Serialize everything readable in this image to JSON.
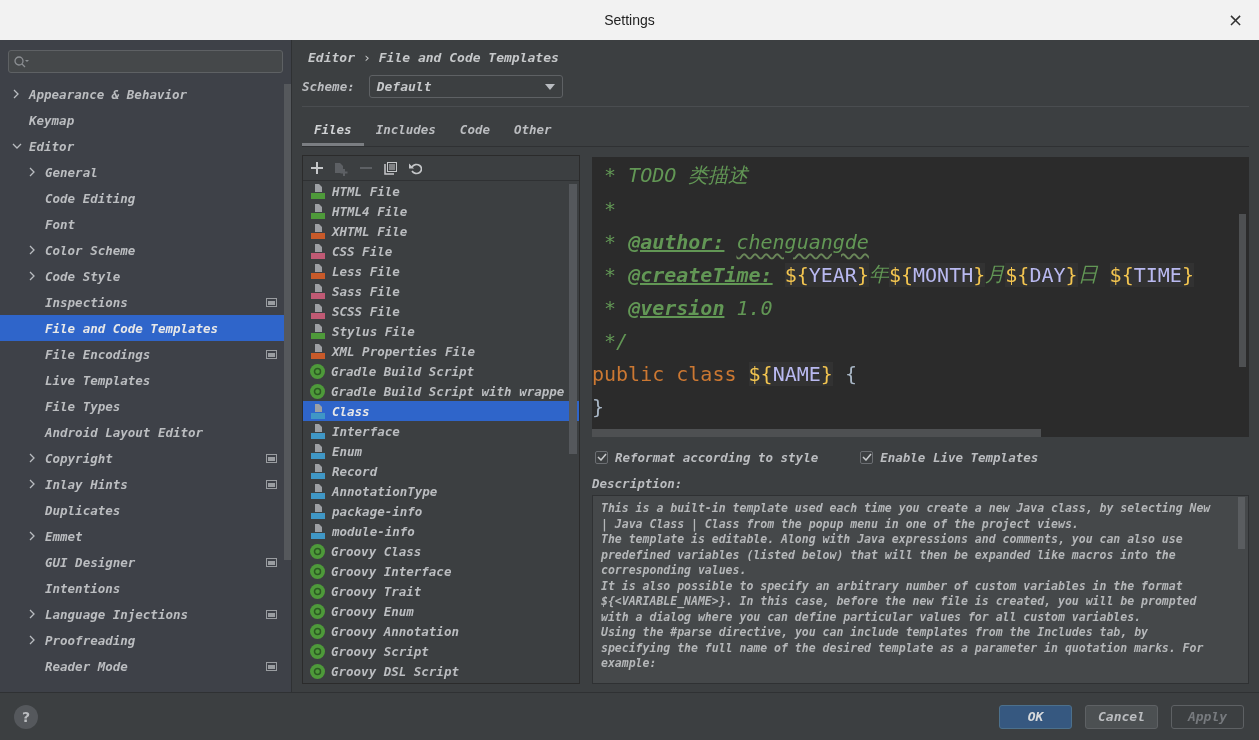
{
  "window": {
    "title": "Settings",
    "close": "×"
  },
  "sidebar": {
    "items": [
      {
        "label": "Appearance & Behavior",
        "expandable": true,
        "expanded": false,
        "project": false,
        "selected": false
      },
      {
        "label": "Keymap",
        "expandable": false,
        "project": false,
        "selected": false
      },
      {
        "label": "Editor",
        "expandable": true,
        "expanded": true,
        "project": false,
        "selected": false,
        "children": [
          {
            "label": "General",
            "expandable": true,
            "expanded": false,
            "project": false,
            "selected": false
          },
          {
            "label": "Code Editing",
            "expandable": false,
            "project": false,
            "selected": false
          },
          {
            "label": "Font",
            "expandable": false,
            "project": false,
            "selected": false
          },
          {
            "label": "Color Scheme",
            "expandable": true,
            "expanded": false,
            "project": false,
            "selected": false
          },
          {
            "label": "Code Style",
            "expandable": true,
            "expanded": false,
            "project": false,
            "selected": false
          },
          {
            "label": "Inspections",
            "expandable": false,
            "project": true,
            "selected": false
          },
          {
            "label": "File and Code Templates",
            "expandable": false,
            "project": false,
            "selected": true
          },
          {
            "label": "File Encodings",
            "expandable": false,
            "project": true,
            "selected": false
          },
          {
            "label": "Live Templates",
            "expandable": false,
            "project": false,
            "selected": false
          },
          {
            "label": "File Types",
            "expandable": false,
            "project": false,
            "selected": false
          },
          {
            "label": "Android Layout Editor",
            "expandable": false,
            "project": false,
            "selected": false
          },
          {
            "label": "Copyright",
            "expandable": true,
            "expanded": false,
            "project": true,
            "selected": false
          },
          {
            "label": "Inlay Hints",
            "expandable": true,
            "expanded": false,
            "project": true,
            "selected": false
          },
          {
            "label": "Duplicates",
            "expandable": false,
            "project": false,
            "selected": false
          },
          {
            "label": "Emmet",
            "expandable": true,
            "expanded": false,
            "project": false,
            "selected": false
          },
          {
            "label": "GUI Designer",
            "expandable": false,
            "project": true,
            "selected": false
          },
          {
            "label": "Intentions",
            "expandable": false,
            "project": false,
            "selected": false
          },
          {
            "label": "Language Injections",
            "expandable": true,
            "expanded": false,
            "project": true,
            "selected": false
          },
          {
            "label": "Proofreading",
            "expandable": true,
            "expanded": false,
            "project": false,
            "selected": false
          },
          {
            "label": "Reader Mode",
            "expandable": false,
            "project": true,
            "selected": false
          }
        ]
      }
    ]
  },
  "breadcrumb": {
    "parent": "Editor",
    "separator": "›",
    "current": "File and Code Templates"
  },
  "scheme": {
    "label": "Scheme:",
    "value": "Default"
  },
  "tabs": [
    {
      "label": "Files",
      "selected": true
    },
    {
      "label": "Includes",
      "selected": false
    },
    {
      "label": "Code",
      "selected": false
    },
    {
      "label": "Other",
      "selected": false
    }
  ],
  "toolbar": [
    {
      "kind": "add",
      "disabled": false
    },
    {
      "kind": "copy-file",
      "disabled": true
    },
    {
      "kind": "remove",
      "disabled": true
    },
    {
      "kind": "copy",
      "disabled": false
    },
    {
      "kind": "reset",
      "disabled": false
    }
  ],
  "templates": [
    {
      "name": "HTML File",
      "kind": "file",
      "color": "#4e9a3a",
      "selected": false
    },
    {
      "name": "HTML4 File",
      "kind": "file",
      "color": "#4e9a3a",
      "selected": false
    },
    {
      "name": "XHTML File",
      "kind": "file",
      "color": "#c85a2a",
      "selected": false
    },
    {
      "name": "CSS File",
      "kind": "file",
      "color": "#c05a74",
      "selected": false
    },
    {
      "name": "Less File",
      "kind": "file",
      "color": "#c85a2a",
      "selected": false
    },
    {
      "name": "Sass File",
      "kind": "file",
      "color": "#c05a74",
      "selected": false
    },
    {
      "name": "SCSS File",
      "kind": "file",
      "color": "#c05a74",
      "selected": false
    },
    {
      "name": "Stylus File",
      "kind": "file",
      "color": "#4e9a3a",
      "selected": false
    },
    {
      "name": "XML Properties File",
      "kind": "file",
      "color": "#c85a2a",
      "selected": false
    },
    {
      "name": "Gradle Build Script",
      "kind": "groovy",
      "color": "#4e9a3a",
      "selected": false
    },
    {
      "name": "Gradle Build Script with wrappe",
      "kind": "groovy",
      "color": "#4e9a3a",
      "selected": false
    },
    {
      "name": "Class",
      "kind": "file",
      "color": "#3f97c6",
      "selected": true
    },
    {
      "name": "Interface",
      "kind": "file",
      "color": "#3f97c6",
      "selected": false
    },
    {
      "name": "Enum",
      "kind": "file",
      "color": "#3f97c6",
      "selected": false
    },
    {
      "name": "Record",
      "kind": "file",
      "color": "#3f97c6",
      "selected": false
    },
    {
      "name": "AnnotationType",
      "kind": "file",
      "color": "#3f97c6",
      "selected": false
    },
    {
      "name": "package-info",
      "kind": "file",
      "color": "#3f97c6",
      "selected": false
    },
    {
      "name": "module-info",
      "kind": "file",
      "color": "#3f97c6",
      "selected": false
    },
    {
      "name": "Groovy Class",
      "kind": "groovy",
      "color": "#4e9a3a",
      "selected": false
    },
    {
      "name": "Groovy Interface",
      "kind": "groovy",
      "color": "#4e9a3a",
      "selected": false
    },
    {
      "name": "Groovy Trait",
      "kind": "groovy",
      "color": "#4e9a3a",
      "selected": false
    },
    {
      "name": "Groovy Enum",
      "kind": "groovy",
      "color": "#4e9a3a",
      "selected": false
    },
    {
      "name": "Groovy Annotation",
      "kind": "groovy",
      "color": "#4e9a3a",
      "selected": false
    },
    {
      "name": "Groovy Script",
      "kind": "groovy",
      "color": "#4e9a3a",
      "selected": false
    },
    {
      "name": "Groovy DSL Script",
      "kind": "groovy",
      "color": "#4e9a3a",
      "selected": false
    }
  ],
  "code": [
    [
      {
        "kind": "comment",
        "text": " * TODO 类描述"
      }
    ],
    [
      {
        "kind": "comment",
        "text": " *"
      }
    ],
    [
      {
        "kind": "comment",
        "text": " * "
      },
      {
        "kind": "tag",
        "text": "@author:"
      },
      {
        "kind": "typo",
        "text": "chenguangde"
      }
    ],
    [
      {
        "kind": "comment",
        "text": " * "
      },
      {
        "kind": "tag",
        "text": "@createTime:"
      },
      {
        "kind": "var",
        "open": "${",
        "name": "YEAR",
        "close": "}"
      },
      {
        "kind": "comment",
        "text": "年"
      },
      {
        "kind": "var",
        "open": "${",
        "name": "MONTH",
        "close": "}"
      },
      {
        "kind": "comment",
        "text": "月"
      },
      {
        "kind": "var",
        "open": "${",
        "name": "DAY",
        "close": "}"
      },
      {
        "kind": "comment",
        "text": "日 "
      },
      {
        "kind": "var",
        "open": "${",
        "name": "TIME",
        "close": "}"
      }
    ],
    [
      {
        "kind": "comment",
        "text": " * "
      },
      {
        "kind": "tag",
        "text": "@version"
      },
      {
        "kind": "comment",
        "text": "1.0"
      }
    ],
    [
      {
        "kind": "comment",
        "text": " */"
      }
    ],
    [
      {
        "kind": "keyword",
        "text": "public class "
      },
      {
        "kind": "var",
        "open": "${",
        "name": "NAME",
        "close": "}"
      },
      {
        "kind": "plain",
        "text": " {"
      }
    ],
    [
      {
        "kind": "plain",
        "text": "}"
      }
    ]
  ],
  "options": [
    {
      "label": "Reformat according to style",
      "checked": true
    },
    {
      "label": "Enable Live Templates",
      "checked": true
    }
  ],
  "description": {
    "label": "Description:",
    "paragraphs": [
      "This is a built-in template used each time you create a new Java class, by selecting New | Java Class | Class from the popup menu in one of the project views.",
      "The template is editable. Along with Java expressions and comments, you can also use predefined variables (listed below) that will then be expanded like macros into the corresponding values.",
      "It is also possible to specify an arbitrary number of custom variables in the format **${<VARIABLE_NAME>}**. In this case, before the new file is created, you will be prompted with a dialog where you can define particular values for all custom variables.",
      "Using the **#parse** directive, you can include templates from the Includes tab, by specifying the full name of the desired template as a parameter in quotation marks. For example:"
    ]
  },
  "help": "?",
  "buttons": [
    {
      "label": "OK",
      "kind": "default",
      "disabled": false
    },
    {
      "label": "Cancel",
      "kind": "normal",
      "disabled": false
    },
    {
      "label": "Apply",
      "kind": "normal",
      "disabled": true
    }
  ]
}
